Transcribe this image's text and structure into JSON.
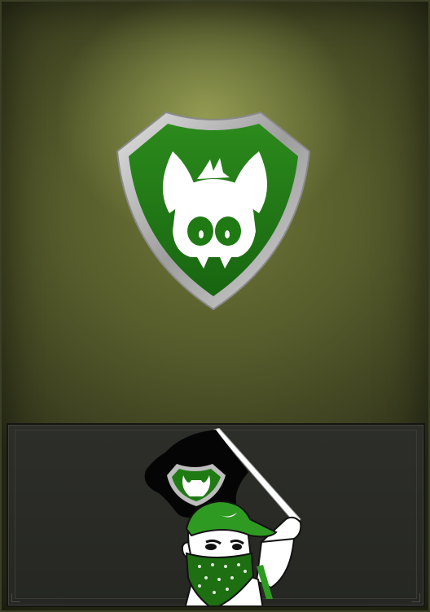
{
  "card": {
    "background_color": "#555b2b",
    "highlight_color": "#c2c86e"
  },
  "emblem": {
    "icon": "boar-shield-icon",
    "shield_color": "#1f7a14",
    "rim_color": "#b5b5b5",
    "face_color": "#ffffff"
  },
  "panel": {
    "background_color": "#2a2b27",
    "mascot_icon": "flag-bearer-mascot-icon",
    "cap_color": "#2f9a22",
    "bandana_color": "#1e6e12",
    "flag_color": "#050505"
  }
}
